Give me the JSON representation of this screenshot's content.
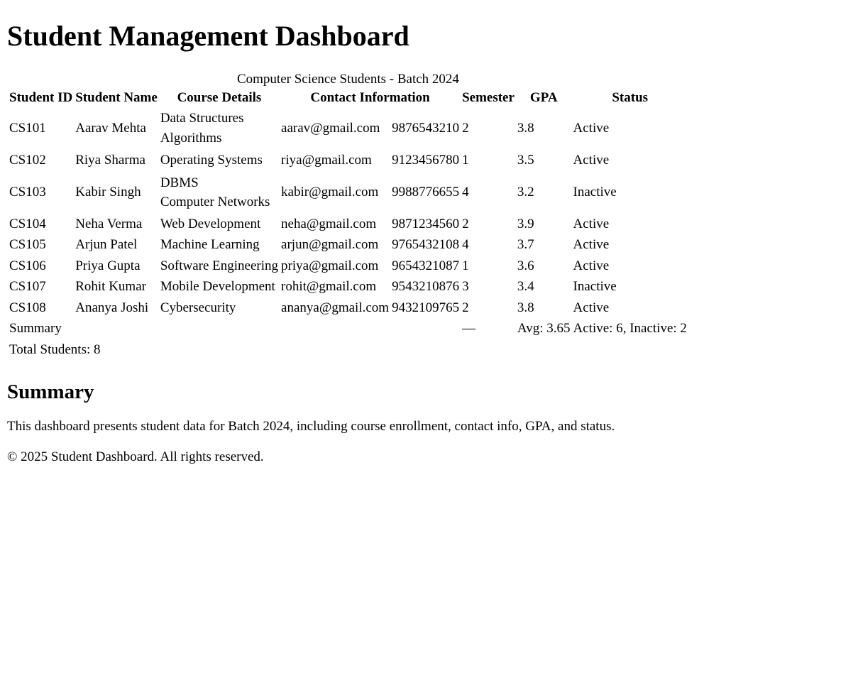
{
  "page": {
    "title": "Student Management Dashboard"
  },
  "table": {
    "caption": "Computer Science Students - Batch 2024",
    "headers": {
      "student_id": "Student ID",
      "student_name": "Student Name",
      "course_details": "Course Details",
      "contact_information": "Contact Information",
      "semester": "Semester",
      "gpa": "GPA",
      "status": "Status"
    },
    "rows": [
      {
        "id": "CS101",
        "name": "Aarav Mehta",
        "courses": [
          "Data Structures",
          "Algorithms"
        ],
        "email": "aarav@gmail.com",
        "phone": "9876543210",
        "semester": "2",
        "gpa": "3.8",
        "status": "Active"
      },
      {
        "id": "CS102",
        "name": "Riya Sharma",
        "courses": [
          "Operating Systems"
        ],
        "email": "riya@gmail.com",
        "phone": "9123456780",
        "semester": "1",
        "gpa": "3.5",
        "status": "Active"
      },
      {
        "id": "CS103",
        "name": "Kabir Singh",
        "courses": [
          "DBMS",
          "Computer Networks"
        ],
        "email": "kabir@gmail.com",
        "phone": "9988776655",
        "semester": "4",
        "gpa": "3.2",
        "status": "Inactive"
      },
      {
        "id": "CS104",
        "name": "Neha Verma",
        "courses": [
          "Web Development"
        ],
        "email": "neha@gmail.com",
        "phone": "9871234560",
        "semester": "2",
        "gpa": "3.9",
        "status": "Active"
      },
      {
        "id": "CS105",
        "name": "Arjun Patel",
        "courses": [
          "Machine Learning"
        ],
        "email": "arjun@gmail.com",
        "phone": "9765432108",
        "semester": "4",
        "gpa": "3.7",
        "status": "Active"
      },
      {
        "id": "CS106",
        "name": "Priya Gupta",
        "courses": [
          "Software Engineering"
        ],
        "email": "priya@gmail.com",
        "phone": "9654321087",
        "semester": "1",
        "gpa": "3.6",
        "status": "Active"
      },
      {
        "id": "CS107",
        "name": "Rohit Kumar",
        "courses": [
          "Mobile Development"
        ],
        "email": "rohit@gmail.com",
        "phone": "9543210876",
        "semester": "3",
        "gpa": "3.4",
        "status": "Inactive"
      },
      {
        "id": "CS108",
        "name": "Ananya Joshi",
        "courses": [
          "Cybersecurity"
        ],
        "email": "ananya@gmail.com",
        "phone": "9432109765",
        "semester": "2",
        "gpa": "3.8",
        "status": "Active"
      }
    ],
    "summary_row": {
      "label": "Summary",
      "semester": "—",
      "gpa": "Avg: 3.65",
      "status": "Active: 6, Inactive: 2"
    },
    "total_row": {
      "label": "Total Students: 8"
    }
  },
  "summary": {
    "heading": "Summary",
    "text": "This dashboard presents student data for Batch 2024, including course enrollment, contact info, GPA, and status."
  },
  "footer": {
    "text": "© 2025 Student Dashboard. All rights reserved."
  }
}
